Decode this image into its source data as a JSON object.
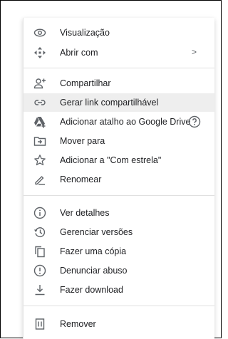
{
  "menu": {
    "items": [
      {
        "label": "Visualização",
        "icon": "eye-icon"
      },
      {
        "label": "Abrir com",
        "icon": "move-arrows-icon",
        "chevron": ">"
      },
      {
        "label": "Compartilhar",
        "icon": "add-person-icon"
      },
      {
        "label": "Gerar link compartilhável",
        "icon": "link-icon",
        "highlighted": true
      },
      {
        "label": "Adicionar atalho ao Google Drive",
        "icon": "drive-shortcut-icon"
      },
      {
        "label": "Mover para",
        "icon": "move-to-folder-icon"
      },
      {
        "label": "Adicionar a \"Com estrela\"",
        "icon": "star-outline-icon"
      },
      {
        "label": "Renomear",
        "icon": "pencil-icon"
      },
      {
        "label": "Ver detalhes",
        "icon": "info-icon"
      },
      {
        "label": "Gerenciar versões",
        "icon": "history-icon"
      },
      {
        "label": "Fazer uma cópia",
        "icon": "copy-icon"
      },
      {
        "label": "Denunciar abuso",
        "icon": "report-icon"
      },
      {
        "label": "Fazer download",
        "icon": "download-icon"
      },
      {
        "label": "Remover",
        "icon": "trash-icon"
      }
    ]
  },
  "colors": {
    "text": "#202124",
    "icon": "#5f6368",
    "highlight": "#eeeeee",
    "divider": "#e0e0e0"
  }
}
